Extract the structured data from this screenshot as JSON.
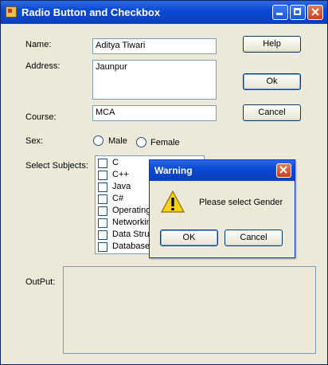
{
  "window": {
    "title": "Radio Button and Checkbox",
    "icons": {
      "app": "app-form-icon",
      "minimize": "minimize-icon",
      "maximize": "maximize-icon",
      "close": "close-icon"
    }
  },
  "form": {
    "name_label": "Name:",
    "name_value": "Aditya Tiwari",
    "address_label": "Address:",
    "address_value": "Jaunpur",
    "course_label": "Course:",
    "course_value": "MCA",
    "sex_label": "Sex:",
    "sex_options": [
      "Male",
      "Female"
    ],
    "subjects_label": "Select Subjects:",
    "subjects": [
      "C",
      "C++",
      "Java",
      "C#",
      "Operating",
      "Networking",
      "Data Stru",
      "Database"
    ],
    "output_label": "OutPut:",
    "output_value": ""
  },
  "buttons": {
    "help": "Help",
    "ok": "Ok",
    "cancel": "Cancel"
  },
  "dialog": {
    "title": "Warning",
    "message": "Please select Gender",
    "ok": "OK",
    "cancel": "Cancel",
    "icons": {
      "warning": "warning-icon",
      "close": "close-icon"
    }
  },
  "colors": {
    "titlebar": "#0a4ad4",
    "window_bg": "#ece9d8",
    "dialog_close": "#c8401e",
    "warning_yellow": "#f7d21a"
  }
}
